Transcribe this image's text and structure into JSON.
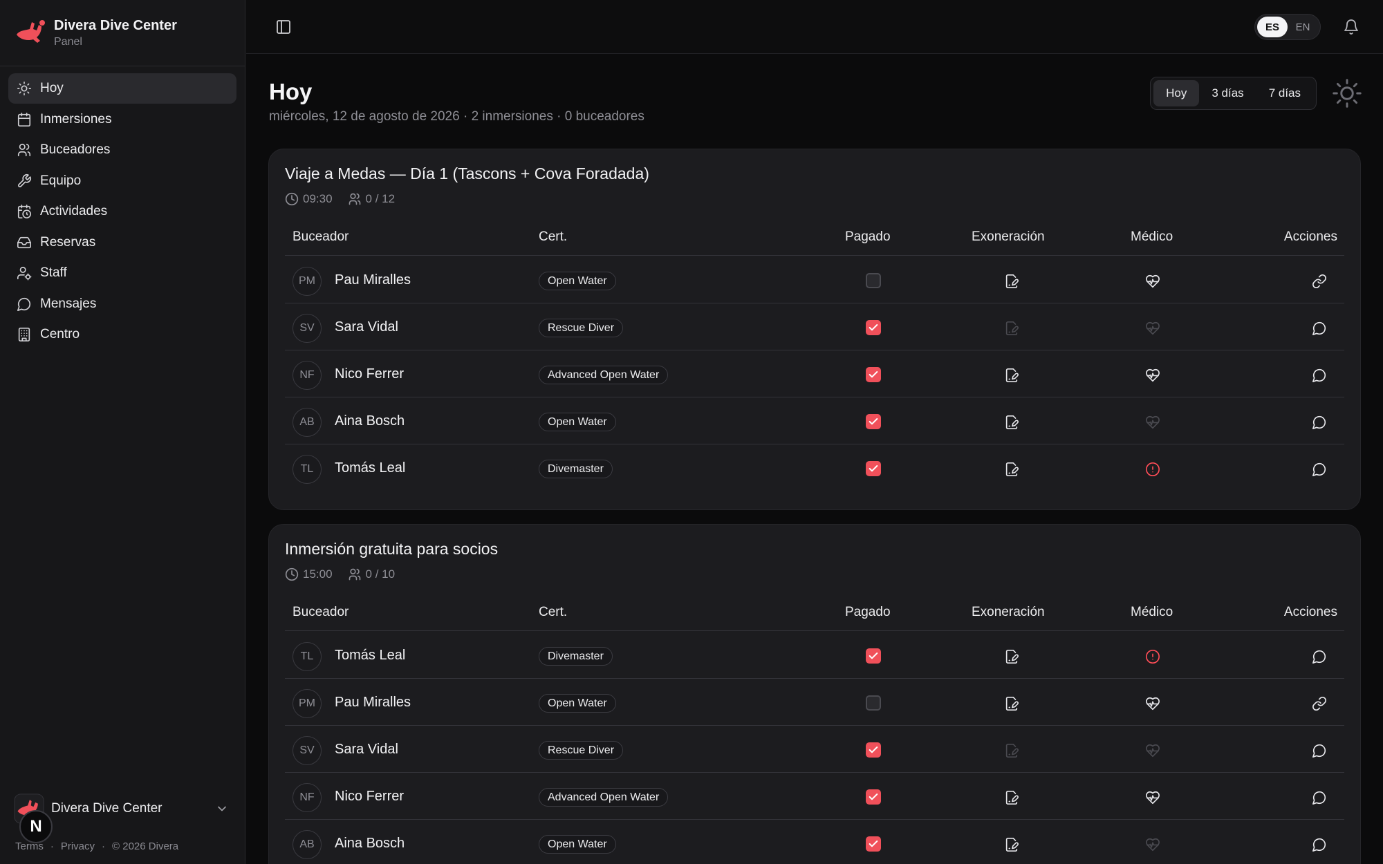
{
  "sidebar": {
    "brand_name": "Divera Dive Center",
    "brand_sub": "Panel",
    "items": [
      {
        "label": "Hoy",
        "icon": "sun-icon",
        "active": true
      },
      {
        "label": "Inmersiones",
        "icon": "calendar-icon"
      },
      {
        "label": "Buceadores",
        "icon": "users-icon"
      },
      {
        "label": "Equipo",
        "icon": "wrench-icon"
      },
      {
        "label": "Actividades",
        "icon": "calendar-clock-icon"
      },
      {
        "label": "Reservas",
        "icon": "inbox-icon"
      },
      {
        "label": "Staff",
        "icon": "user-cog-icon"
      },
      {
        "label": "Mensajes",
        "icon": "message-circle-icon"
      },
      {
        "label": "Centro",
        "icon": "building-icon"
      }
    ],
    "account_name": "Divera Dive Center",
    "legal": {
      "terms": "Terms",
      "privacy": "Privacy",
      "copyright": "© 2026 Divera",
      "sep": "·"
    },
    "badge": "N"
  },
  "topbar": {
    "lang": [
      "ES",
      "EN"
    ],
    "lang_active": "ES"
  },
  "header": {
    "title": "Hoy",
    "subtitle": "miércoles, 12 de agosto de 2026 · 2 inmersiones · 0 buceadores",
    "ranges": [
      "Hoy",
      "3 días",
      "7 días"
    ],
    "range_active": "Hoy"
  },
  "columns": {
    "diver": "Buceador",
    "cert": "Cert.",
    "paid": "Pagado",
    "waiver": "Exoneración",
    "medical": "Médico",
    "actions": "Acciones"
  },
  "colors": {
    "accent": "#f0505a",
    "alert": "#ff4d57",
    "background": "#0b0b0c",
    "card": "#1c1c1f"
  },
  "dives": [
    {
      "title": "Viaje a Medas — Día 1 (Tascons + Cova Foradada)",
      "time": "09:30",
      "capacity": "0 / 12",
      "rows": [
        {
          "initials": "PM",
          "name": "Pau Miralles",
          "cert": "Open Water",
          "paid": false,
          "waiver": "signed",
          "medical": "ok",
          "action": "link-icon"
        },
        {
          "initials": "SV",
          "name": "Sara Vidal",
          "cert": "Rescue Diver",
          "paid": true,
          "waiver": "missing",
          "medical": "missing",
          "action": "message-icon"
        },
        {
          "initials": "NF",
          "name": "Nico Ferrer",
          "cert": "Advanced Open Water",
          "paid": true,
          "waiver": "signed",
          "medical": "ok",
          "action": "message-icon"
        },
        {
          "initials": "AB",
          "name": "Aina Bosch",
          "cert": "Open Water",
          "paid": true,
          "waiver": "signed",
          "medical": "missing",
          "action": "message-icon"
        },
        {
          "initials": "TL",
          "name": "Tomás Leal",
          "cert": "Divemaster",
          "paid": true,
          "waiver": "signed",
          "medical": "alert",
          "action": "message-icon"
        }
      ]
    },
    {
      "title": "Inmersión gratuita para socios",
      "time": "15:00",
      "capacity": "0 / 10",
      "rows": [
        {
          "initials": "TL",
          "name": "Tomás Leal",
          "cert": "Divemaster",
          "paid": true,
          "waiver": "signed",
          "medical": "alert",
          "action": "message-icon"
        },
        {
          "initials": "PM",
          "name": "Pau Miralles",
          "cert": "Open Water",
          "paid": false,
          "waiver": "signed",
          "medical": "ok",
          "action": "link-icon"
        },
        {
          "initials": "SV",
          "name": "Sara Vidal",
          "cert": "Rescue Diver",
          "paid": true,
          "waiver": "missing",
          "medical": "missing",
          "action": "message-icon"
        },
        {
          "initials": "NF",
          "name": "Nico Ferrer",
          "cert": "Advanced Open Water",
          "paid": true,
          "waiver": "signed",
          "medical": "ok",
          "action": "message-icon"
        },
        {
          "initials": "AB",
          "name": "Aina Bosch",
          "cert": "Open Water",
          "paid": true,
          "waiver": "signed",
          "medical": "missing",
          "action": "message-icon"
        }
      ]
    }
  ]
}
